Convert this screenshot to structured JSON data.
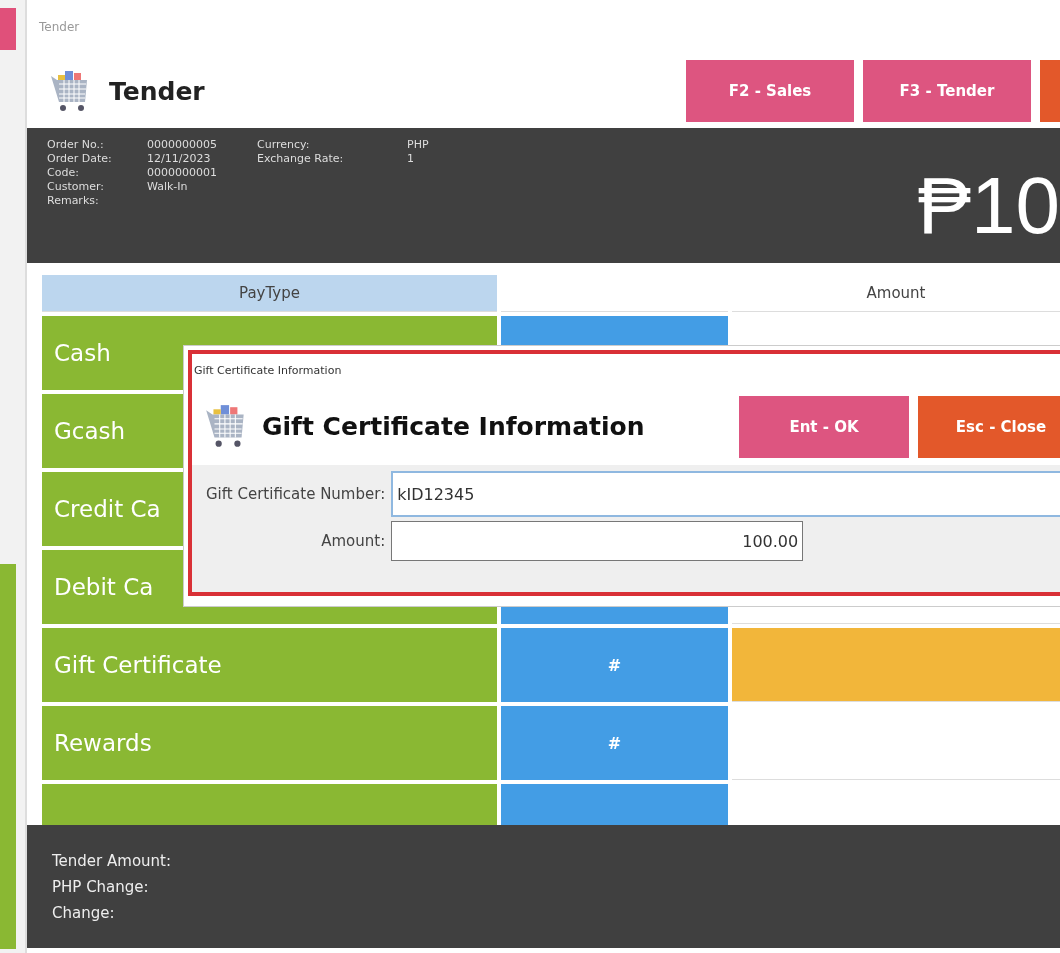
{
  "window": {
    "title": "Tender"
  },
  "header": {
    "title": "Tender",
    "buttons": [
      {
        "label": "F2 - Sales",
        "kind": "pink"
      },
      {
        "label": "F3 - Tender",
        "kind": "pink"
      }
    ]
  },
  "order_info": {
    "left": [
      {
        "label": "Order No.:",
        "value": "0000000005"
      },
      {
        "label": "Order Date:",
        "value": "12/11/2023"
      },
      {
        "label": "Code:",
        "value": "0000000001"
      },
      {
        "label": "Customer:",
        "value": "Walk-In"
      },
      {
        "label": "Remarks:"
      }
    ],
    "right": [
      {
        "label": "Currency:",
        "value": "PHP"
      },
      {
        "label": "Exchange Rate:",
        "value": "1"
      }
    ],
    "total": "₱10"
  },
  "table": {
    "columns": [
      {
        "label": "PayType"
      },
      {},
      {
        "label": "Amount"
      }
    ],
    "rows": [
      {
        "paytype": "Cash"
      },
      {
        "paytype": "Gcash"
      },
      {
        "paytype": "Credit Ca"
      },
      {
        "paytype": "Debit Ca"
      },
      {
        "paytype": "Gift Certificate",
        "hash": "#",
        "selected": true
      },
      {
        "paytype": "Rewards",
        "hash": "#",
        "selected": false
      },
      {}
    ]
  },
  "dialog": {
    "window_title": "Gift Certificate Information",
    "title": "Gift Certificate Information",
    "buttons": [
      {
        "label": "Ent - OK",
        "kind": "pink"
      },
      {
        "label": "Esc - Close",
        "kind": "orange"
      }
    ],
    "fields": [
      {
        "label": "Gift Certificate Number:",
        "value": "kID12345",
        "focused": true,
        "kind": "wide"
      },
      {
        "label": "Amount:",
        "value": "100.00",
        "focused": false,
        "kind": "number"
      }
    ]
  },
  "footer": [
    {
      "label": "Tender Amount:"
    },
    {
      "label": "PHP Change:"
    },
    {
      "label": "Change:"
    }
  ]
}
